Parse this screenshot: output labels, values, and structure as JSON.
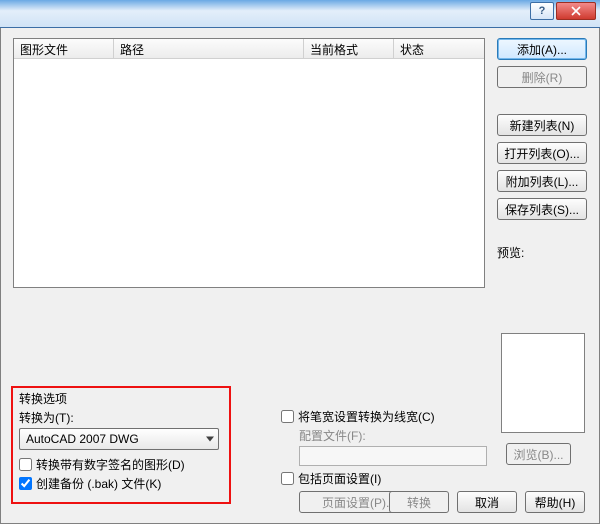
{
  "titlebar": {
    "help_symbol": "?",
    "close_symbol": "X"
  },
  "listview": {
    "columns": [
      "图形文件",
      "路径",
      "当前格式",
      "状态"
    ]
  },
  "buttons": {
    "add": "添加(A)...",
    "remove": "删除(R)",
    "new_list": "新建列表(N)",
    "open_list": "打开列表(O)...",
    "append_list": "附加列表(L)...",
    "save_list": "保存列表(S)...",
    "browse": "浏览(B)...",
    "page_setup": "页面设置(P)...",
    "convert": "转换",
    "cancel": "取消",
    "help": "帮助(H)"
  },
  "labels": {
    "preview": "预览:",
    "convert_options": "转换选项",
    "convert_to": "转换为(T):",
    "convert_signed": "转换带有数字签名的图形(D)",
    "create_backup": "创建备份 (.bak) 文件(K)",
    "pen_to_lineweight": "将笔宽设置转换为线宽(C)",
    "config_file": "配置文件(F):",
    "include_page_setup": "包括页面设置(I)"
  },
  "combo": {
    "selected": "AutoCAD 2007 DWG"
  },
  "checkbox_state": {
    "convert_signed": false,
    "create_backup": true,
    "pen_to_lineweight": false,
    "include_page_setup": false
  },
  "config_file_value": ""
}
